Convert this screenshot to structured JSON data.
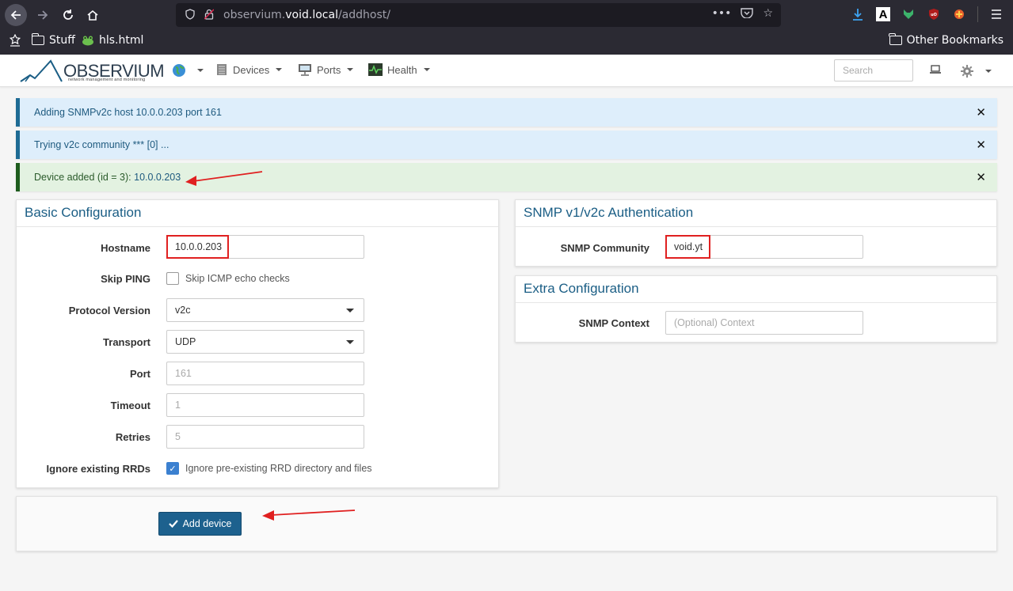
{
  "browser": {
    "url_prefix": "observium.",
    "url_domain": "void.local",
    "url_path": "/addhost/",
    "bookmarks": [
      {
        "label": "Stuff"
      },
      {
        "label": "hls.html"
      }
    ],
    "other_bookmarks": "Other Bookmarks"
  },
  "app": {
    "logo_name": "OBSERVIUM",
    "logo_sub": "network management and monitoring",
    "nav": [
      {
        "label": "Devices"
      },
      {
        "label": "Ports"
      },
      {
        "label": "Health"
      }
    ],
    "search_placeholder": "Search"
  },
  "alerts": [
    {
      "type": "info",
      "text": "Adding SNMPv2c host 10.0.0.203 port 161"
    },
    {
      "type": "info",
      "text": "Trying v2c community *** [0] ..."
    },
    {
      "type": "success",
      "text_prefix": "Device added (id = 3): ",
      "link": "10.0.0.203"
    }
  ],
  "basic": {
    "title": "Basic Configuration",
    "hostname_label": "Hostname",
    "hostname_value": "10.0.0.203",
    "skip_ping_label": "Skip PING",
    "skip_ping_text": "Skip ICMP echo checks",
    "skip_ping_checked": false,
    "protocol_label": "Protocol Version",
    "protocol_value": "v2c",
    "transport_label": "Transport",
    "transport_value": "UDP",
    "port_label": "Port",
    "port_placeholder": "161",
    "timeout_label": "Timeout",
    "timeout_placeholder": "1",
    "retries_label": "Retries",
    "retries_placeholder": "5",
    "ignore_label": "Ignore existing RRDs",
    "ignore_text": "Ignore pre-existing RRD directory and files",
    "ignore_checked": true
  },
  "snmp": {
    "title": "SNMP v1/v2c Authentication",
    "community_label": "SNMP Community",
    "community_value": "void.yt"
  },
  "extra": {
    "title": "Extra Configuration",
    "context_label": "SNMP Context",
    "context_placeholder": "(Optional) Context"
  },
  "actions": {
    "add_device": "Add device"
  },
  "colors": {
    "accent": "#1d618e",
    "annotation": "#e02020",
    "info_bg": "#deeefb",
    "success_bg": "#e3f2e1"
  }
}
